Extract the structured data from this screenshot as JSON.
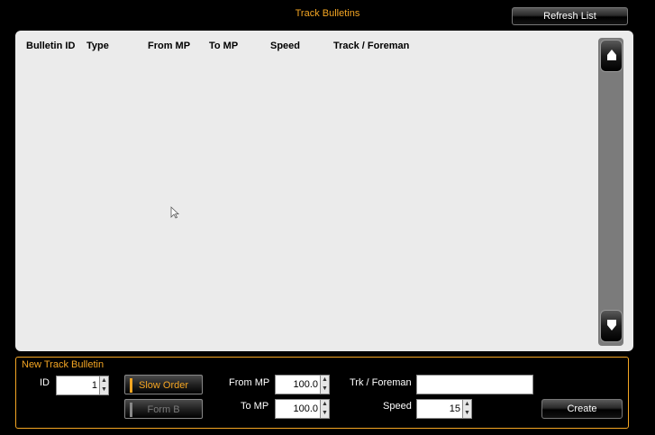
{
  "header": {
    "title": "Track Bulletins",
    "refresh_label": "Refresh List"
  },
  "list": {
    "columns": [
      "Bulletin ID",
      "Type",
      "From MP",
      "To MP",
      "Speed",
      "Track / Foreman"
    ],
    "rows": []
  },
  "new_bulletin": {
    "title": "New Track Bulletin",
    "id_label": "ID",
    "id_value": "1",
    "slow_order_label": "Slow Order",
    "form_b_label": "Form B",
    "from_mp_label": "From MP",
    "from_mp_value": "100.0",
    "to_mp_label": "To MP",
    "to_mp_value": "100.0",
    "trk_foreman_label": "Trk / Foreman",
    "trk_foreman_value": "",
    "speed_label": "Speed",
    "speed_value": "15",
    "create_label": "Create"
  },
  "colors": {
    "accent": "#f5a623",
    "background": "#000000",
    "panel": "#ebebeb"
  },
  "icons": {
    "scroll_up": "up-arrow-icon",
    "scroll_down": "down-arrow-icon",
    "spinner": "spinner-arrows-icon"
  }
}
